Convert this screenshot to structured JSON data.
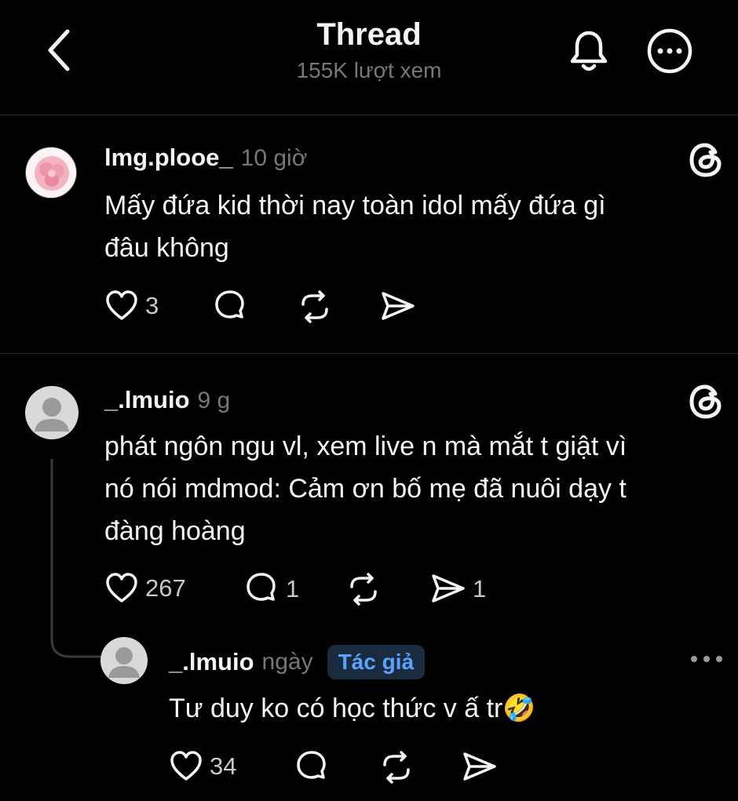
{
  "header": {
    "title": "Thread",
    "views": "155K lượt xem",
    "back_icon": "chevron-left-icon",
    "bell_icon": "bell-icon",
    "more_icon": "more-circle-icon"
  },
  "posts": [
    {
      "username": "lmg.plooe_",
      "time": "10 giờ",
      "text_line1": "Mấy đứa kid thời nay toàn idol mấy đứa gì",
      "text_line2": "đâu không",
      "likes": "3",
      "replies": "",
      "reposts": "",
      "shares": ""
    },
    {
      "username": "_.lmuio",
      "time": "9 g",
      "text_line1": "phát ngôn ngu vl, xem live n mà mắt t giật vì",
      "text_line2": "nó nói mdmod: Cảm ơn bố mẹ đã nuôi dạy t",
      "text_line3": "đàng hoàng",
      "likes": "267",
      "replies": "1",
      "reposts": "",
      "shares": "1"
    }
  ],
  "reply": {
    "username": "_.lmuio",
    "time": "ngày",
    "badge": "Tác giả",
    "text": "Tư duy ko có học thức v ấ tr🤣",
    "likes": "34"
  },
  "colors": {
    "background": "#000000",
    "text": "#f3f5f7",
    "muted": "#777777",
    "badge_text": "#5aa3ff",
    "badge_bg": "#1a2a3f",
    "avatar_pink": "#f2a7b5"
  }
}
